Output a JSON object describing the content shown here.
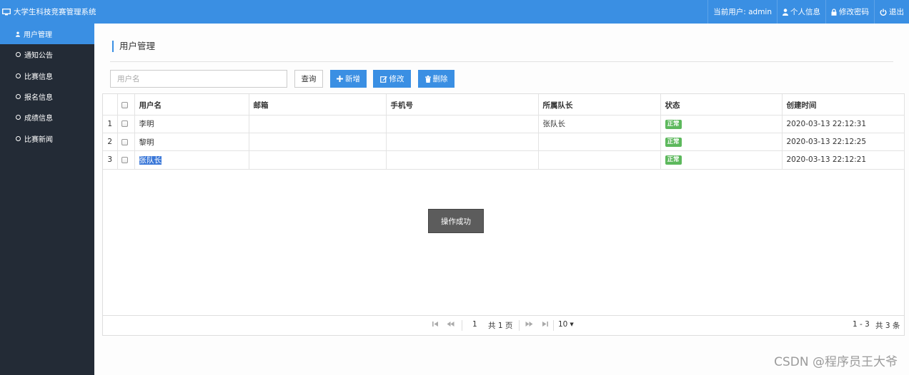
{
  "app": {
    "title": "大学生科技竞赛管理系统",
    "current_user_label": "当前用户: admin",
    "profile_label": "个人信息",
    "change_password_label": "修改密码",
    "logout_label": "退出"
  },
  "sidebar": {
    "items": [
      {
        "label": "用户管理",
        "icon": "user-icon",
        "active": true
      },
      {
        "label": "通知公告",
        "icon": "ring-icon",
        "active": false
      },
      {
        "label": "比赛信息",
        "icon": "ring-icon",
        "active": false
      },
      {
        "label": "报名信息",
        "icon": "ring-icon",
        "active": false
      },
      {
        "label": "成绩信息",
        "icon": "ring-icon",
        "active": false
      },
      {
        "label": "比赛新闻",
        "icon": "ring-icon",
        "active": false
      }
    ]
  },
  "page": {
    "title": "用户管理"
  },
  "toolbar": {
    "search_placeholder": "用户名",
    "search_value": "",
    "query_label": "查询",
    "add_label": "新增",
    "edit_label": "修改",
    "delete_label": "删除"
  },
  "table": {
    "columns": [
      "用户名",
      "邮箱",
      "手机号",
      "所属队长",
      "状态",
      "创建时间"
    ],
    "rows": [
      {
        "num": "1",
        "username": "李明",
        "email": "",
        "phone": "",
        "captain": "张队长",
        "status": "正常",
        "created": "2020-03-13 22:12:31"
      },
      {
        "num": "2",
        "username": "黎明",
        "email": "",
        "phone": "",
        "captain": "",
        "status": "正常",
        "created": "2020-03-13 22:12:25"
      },
      {
        "num": "3",
        "username": "张队长",
        "email": "",
        "phone": "",
        "captain": "",
        "status": "正常",
        "created": "2020-03-13 22:12:21"
      }
    ]
  },
  "pager": {
    "page_number": "1",
    "total_pages_label": "共 1 页",
    "page_size": "10",
    "range_label": "1 - 3",
    "total_label": "共 3 条"
  },
  "toast": {
    "message": "操作成功"
  },
  "watermark": "CSDN @程序员王大爷",
  "colors": {
    "primary": "#3a8fe3",
    "sidebar_bg": "#232b36",
    "status_green": "#5cb85c",
    "toast_bg": "#5c5c5c"
  }
}
